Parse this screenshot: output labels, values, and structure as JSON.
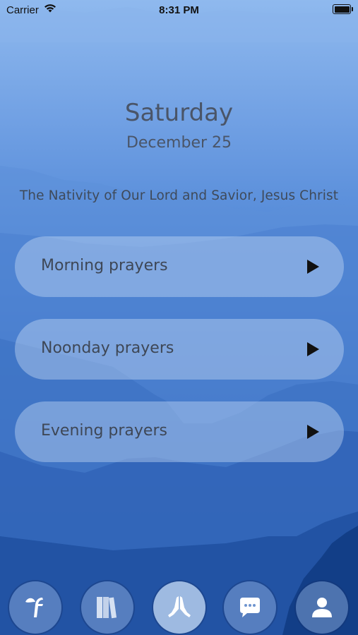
{
  "status_bar": {
    "carrier": "Carrier",
    "time": "8:31 PM"
  },
  "header": {
    "day": "Saturday",
    "date": "December 25",
    "feast": "The Nativity of Our Lord and Savior, Jesus Christ"
  },
  "prayers": [
    {
      "label": "Morning prayers"
    },
    {
      "label": "Noonday prayers"
    },
    {
      "label": "Evening prayers"
    }
  ],
  "tabs": [
    {
      "icon": "leaf-f-logo-icon"
    },
    {
      "icon": "books-icon"
    },
    {
      "icon": "praying-hands-icon",
      "active": true
    },
    {
      "icon": "chat-bubble-icon"
    },
    {
      "icon": "person-icon"
    }
  ]
}
